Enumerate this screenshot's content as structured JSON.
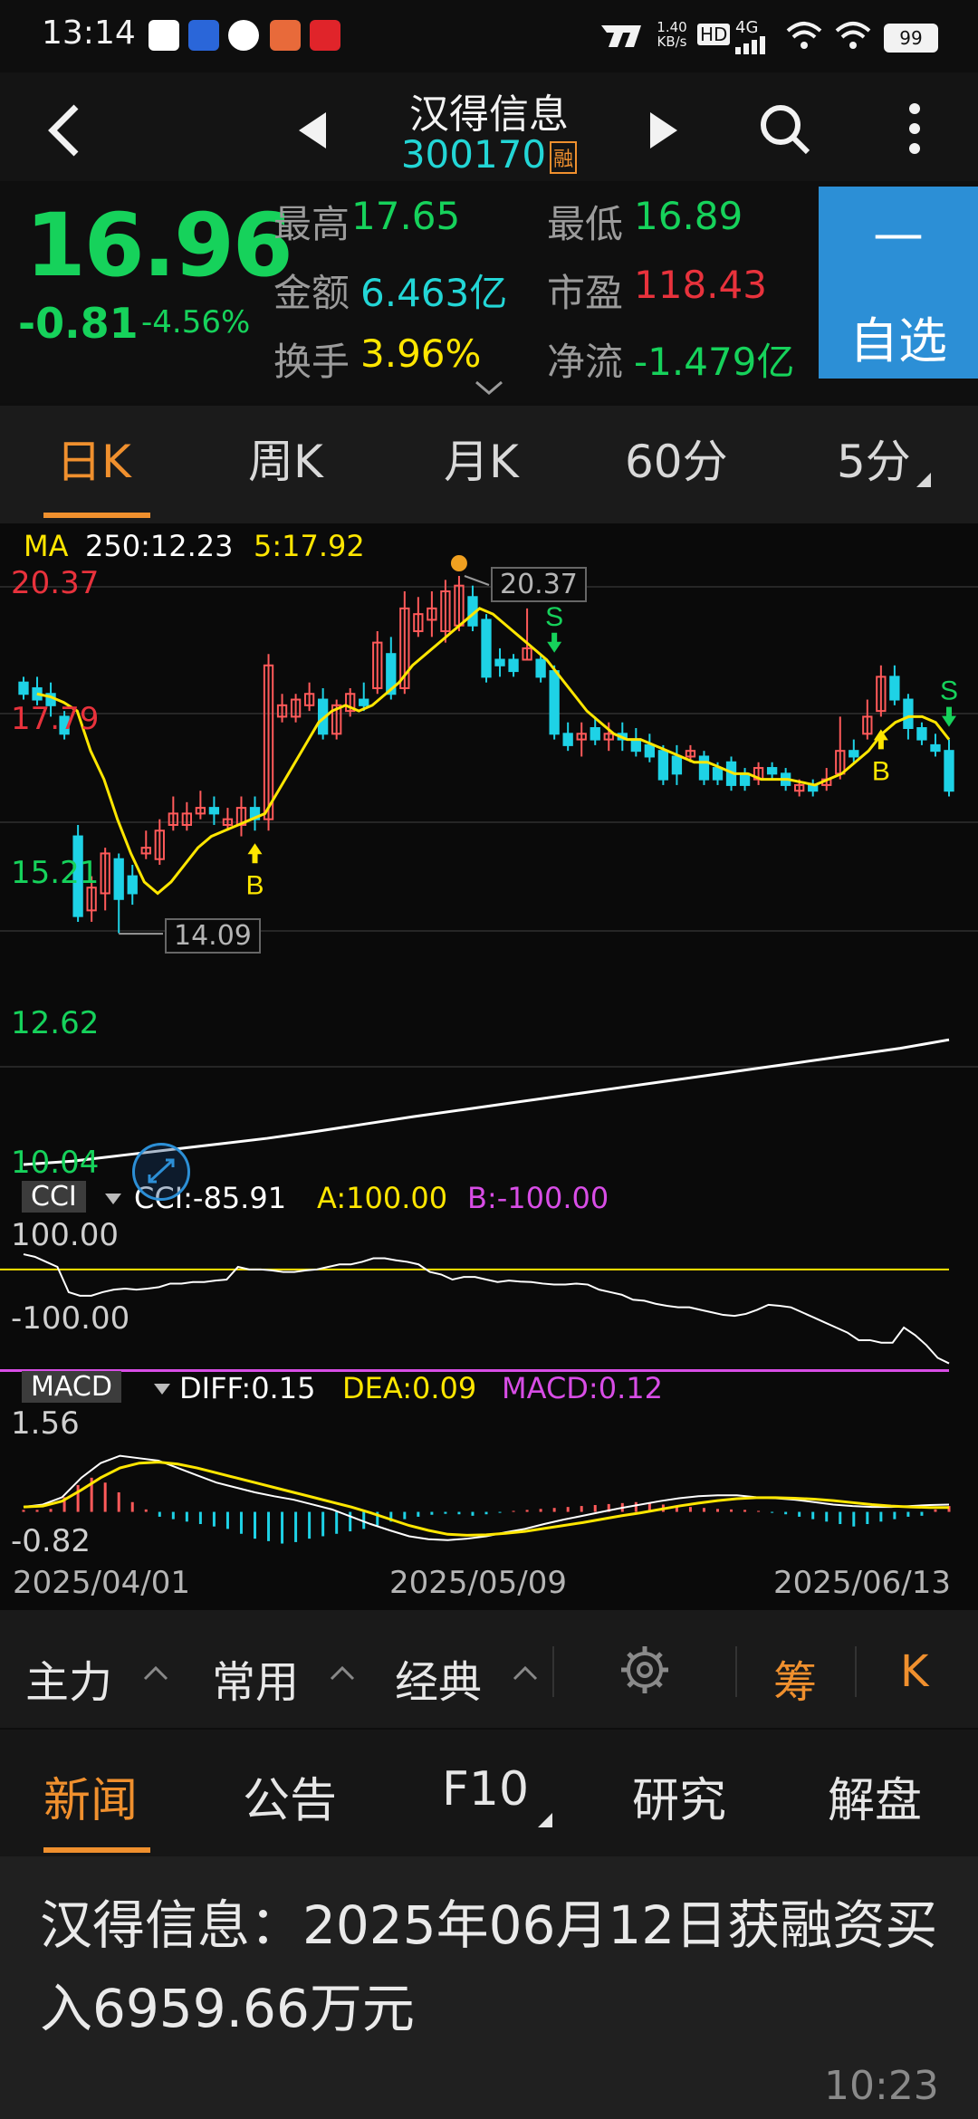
{
  "status": {
    "time": "13:14",
    "net_speed": "1.40\nKB/s",
    "hd": "HD",
    "signal": "4G",
    "battery": "99"
  },
  "header": {
    "title": "汉得信息",
    "code": "300170",
    "margin_badge": "融"
  },
  "quote": {
    "price": "16.96",
    "change": "-0.81",
    "change_pct": "-4.56%",
    "high_label": "最高",
    "high": "17.65",
    "low_label": "最低",
    "low": "16.89",
    "amount_label": "金额",
    "amount": "6.463亿",
    "pe_label": "市盈",
    "pe": "118.43",
    "turnover_label": "换手",
    "turnover": "3.96%",
    "netflow_label": "净流",
    "netflow": "-1.479亿",
    "watch_minus": "—",
    "watch_label": "自选"
  },
  "period_tabs": [
    "日K",
    "周K",
    "月K",
    "60分",
    "5分"
  ],
  "chart_data": [
    {
      "type": "candlestick",
      "title": "",
      "legend": {
        "name": "MA",
        "ma250": "250:12.23",
        "ma5": "5:17.92"
      },
      "y_labels": [
        "20.37",
        "17.79",
        "15.21",
        "12.62",
        "10.04"
      ],
      "annotations": {
        "high": "20.37",
        "low": "14.09",
        "buy": "B",
        "sell": "S"
      },
      "ylim": [
        10.04,
        20.37
      ],
      "candles": [
        {
          "o": 18.5,
          "c": 18.3,
          "h": 18.6,
          "l": 18.2
        },
        {
          "o": 18.4,
          "c": 18.2,
          "h": 18.6,
          "l": 18.1
        },
        {
          "o": 18.3,
          "c": 18.1,
          "h": 18.5,
          "l": 17.9
        },
        {
          "o": 17.9,
          "c": 17.6,
          "h": 18.0,
          "l": 17.5
        },
        {
          "o": 15.8,
          "c": 14.4,
          "h": 16.0,
          "l": 14.3
        },
        {
          "o": 14.5,
          "c": 14.9,
          "h": 15.1,
          "l": 14.3
        },
        {
          "o": 14.8,
          "c": 15.5,
          "h": 15.6,
          "l": 14.5
        },
        {
          "o": 15.4,
          "c": 14.7,
          "h": 15.5,
          "l": 14.1
        },
        {
          "o": 15.1,
          "c": 14.8,
          "h": 15.3,
          "l": 14.6
        },
        {
          "o": 15.5,
          "c": 15.6,
          "h": 15.9,
          "l": 15.4
        },
        {
          "o": 15.4,
          "c": 15.9,
          "h": 16.1,
          "l": 15.3
        },
        {
          "o": 16.0,
          "c": 16.2,
          "h": 16.5,
          "l": 15.9
        },
        {
          "o": 16.0,
          "c": 16.2,
          "h": 16.4,
          "l": 15.9
        },
        {
          "o": 16.2,
          "c": 16.3,
          "h": 16.6,
          "l": 16.1
        },
        {
          "o": 16.3,
          "c": 16.2,
          "h": 16.5,
          "l": 16.0
        },
        {
          "o": 16.0,
          "c": 16.1,
          "h": 16.3,
          "l": 15.9
        },
        {
          "o": 16.0,
          "c": 16.3,
          "h": 16.5,
          "l": 15.8
        },
        {
          "o": 16.3,
          "c": 16.1,
          "h": 16.5,
          "l": 15.9
        },
        {
          "o": 16.1,
          "c": 18.8,
          "h": 19.0,
          "l": 15.9
        },
        {
          "o": 17.9,
          "c": 18.1,
          "h": 18.3,
          "l": 17.8
        },
        {
          "o": 17.9,
          "c": 18.2,
          "h": 18.3,
          "l": 17.8
        },
        {
          "o": 18.1,
          "c": 18.3,
          "h": 18.5,
          "l": 18.0
        },
        {
          "o": 18.2,
          "c": 17.6,
          "h": 18.4,
          "l": 17.5
        },
        {
          "o": 17.6,
          "c": 18.1,
          "h": 18.2,
          "l": 17.5
        },
        {
          "o": 18.0,
          "c": 18.3,
          "h": 18.4,
          "l": 17.9
        },
        {
          "o": 18.2,
          "c": 18.1,
          "h": 18.5,
          "l": 18.0
        },
        {
          "o": 18.4,
          "c": 19.2,
          "h": 19.4,
          "l": 18.3
        },
        {
          "o": 19.0,
          "c": 18.3,
          "h": 19.3,
          "l": 18.2
        },
        {
          "o": 18.4,
          "c": 19.8,
          "h": 20.1,
          "l": 18.3
        },
        {
          "o": 19.4,
          "c": 19.7,
          "h": 20.0,
          "l": 19.3
        },
        {
          "o": 19.6,
          "c": 19.8,
          "h": 20.1,
          "l": 19.3
        },
        {
          "o": 19.4,
          "c": 20.1,
          "h": 20.3,
          "l": 19.2
        },
        {
          "o": 19.5,
          "c": 20.2,
          "h": 20.37,
          "l": 19.4
        },
        {
          "o": 20.0,
          "c": 19.5,
          "h": 20.2,
          "l": 19.4
        },
        {
          "o": 19.6,
          "c": 18.6,
          "h": 19.7,
          "l": 18.5
        },
        {
          "o": 18.9,
          "c": 18.8,
          "h": 19.1,
          "l": 18.6
        },
        {
          "o": 18.9,
          "c": 18.7,
          "h": 19.0,
          "l": 18.6
        },
        {
          "o": 18.9,
          "c": 19.1,
          "h": 19.8,
          "l": 18.9
        },
        {
          "o": 18.9,
          "c": 18.6,
          "h": 19.0,
          "l": 18.5
        },
        {
          "o": 18.7,
          "c": 17.6,
          "h": 18.8,
          "l": 17.5
        },
        {
          "o": 17.6,
          "c": 17.4,
          "h": 17.8,
          "l": 17.3
        },
        {
          "o": 17.5,
          "c": 17.6,
          "h": 17.8,
          "l": 17.2
        },
        {
          "o": 17.7,
          "c": 17.5,
          "h": 17.9,
          "l": 17.4
        },
        {
          "o": 17.5,
          "c": 17.6,
          "h": 17.8,
          "l": 17.3
        },
        {
          "o": 17.6,
          "c": 17.5,
          "h": 17.8,
          "l": 17.3
        },
        {
          "o": 17.5,
          "c": 17.3,
          "h": 17.7,
          "l": 17.2
        },
        {
          "o": 17.4,
          "c": 17.2,
          "h": 17.6,
          "l": 17.1
        },
        {
          "o": 17.3,
          "c": 16.8,
          "h": 17.4,
          "l": 16.7
        },
        {
          "o": 17.2,
          "c": 16.9,
          "h": 17.4,
          "l": 16.7
        },
        {
          "o": 17.2,
          "c": 17.3,
          "h": 17.4,
          "l": 17.1
        },
        {
          "o": 17.2,
          "c": 16.8,
          "h": 17.3,
          "l": 16.7
        },
        {
          "o": 17.0,
          "c": 16.8,
          "h": 17.1,
          "l": 16.7
        },
        {
          "o": 17.1,
          "c": 16.7,
          "h": 17.2,
          "l": 16.6
        },
        {
          "o": 16.9,
          "c": 16.7,
          "h": 17.0,
          "l": 16.6
        },
        {
          "o": 16.8,
          "c": 17.0,
          "h": 17.1,
          "l": 16.7
        },
        {
          "o": 17.0,
          "c": 16.9,
          "h": 17.1,
          "l": 16.8
        },
        {
          "o": 16.9,
          "c": 16.7,
          "h": 17.0,
          "l": 16.6
        },
        {
          "o": 16.6,
          "c": 16.7,
          "h": 16.8,
          "l": 16.5
        },
        {
          "o": 16.7,
          "c": 16.6,
          "h": 16.8,
          "l": 16.5
        },
        {
          "o": 16.7,
          "c": 16.8,
          "h": 17.0,
          "l": 16.6
        },
        {
          "o": 16.9,
          "c": 17.3,
          "h": 17.9,
          "l": 16.8
        },
        {
          "o": 17.3,
          "c": 17.2,
          "h": 17.5,
          "l": 17.1
        },
        {
          "o": 17.6,
          "c": 17.9,
          "h": 18.2,
          "l": 17.5
        },
        {
          "o": 18.0,
          "c": 18.6,
          "h": 18.8,
          "l": 17.9
        },
        {
          "o": 18.6,
          "c": 18.2,
          "h": 18.8,
          "l": 18.1
        },
        {
          "o": 18.2,
          "c": 17.7,
          "h": 18.3,
          "l": 17.5
        },
        {
          "o": 17.7,
          "c": 17.5,
          "h": 17.8,
          "l": 17.4
        },
        {
          "o": 17.4,
          "c": 17.3,
          "h": 17.6,
          "l": 17.2
        },
        {
          "o": 17.3,
          "c": 16.6,
          "h": 17.5,
          "l": 16.5
        }
      ],
      "ma5": [
        18.3,
        18.25,
        18.15,
        18.0,
        17.3,
        16.8,
        16.1,
        15.5,
        15.0,
        14.8,
        15.0,
        15.3,
        15.6,
        15.8,
        15.9,
        16.0,
        16.1,
        16.2,
        16.6,
        17.0,
        17.4,
        17.8,
        18.0,
        18.1,
        18.0,
        18.1,
        18.3,
        18.5,
        18.8,
        19.0,
        19.2,
        19.4,
        19.6,
        19.8,
        19.7,
        19.5,
        19.3,
        19.1,
        18.9,
        18.6,
        18.3,
        18.0,
        17.8,
        17.6,
        17.5,
        17.5,
        17.4,
        17.3,
        17.2,
        17.1,
        17.1,
        17.0,
        16.9,
        16.9,
        16.8,
        16.8,
        16.8,
        16.75,
        16.7,
        16.8,
        16.9,
        17.1,
        17.3,
        17.6,
        17.8,
        17.9,
        17.9,
        17.8,
        17.5
      ],
      "ma250": [
        10.04,
        10.1,
        10.2,
        10.3,
        10.4,
        10.5,
        10.62,
        10.75,
        10.88,
        11.0,
        11.12,
        11.24,
        11.36,
        11.48,
        11.6,
        11.72,
        11.84,
        11.96,
        12.08,
        12.23
      ]
    },
    {
      "type": "line",
      "title": "",
      "legend": {
        "name": "CCI",
        "cci": "CCI:-85.91",
        "a": "A:100.00",
        "b": "B:-100.00"
      },
      "y_labels": [
        "100.00",
        "-100.00"
      ],
      "ylim": [
        -100,
        100
      ],
      "values": [
        130,
        125,
        115,
        105,
        55,
        48,
        48,
        55,
        60,
        62,
        60,
        62,
        65,
        72,
        72,
        75,
        75,
        78,
        80,
        105,
        100,
        100,
        98,
        95,
        95,
        98,
        100,
        105,
        110,
        110,
        115,
        122,
        122,
        118,
        115,
        110,
        95,
        90,
        80,
        85,
        85,
        80,
        75,
        78,
        76,
        75,
        72,
        70,
        70,
        72,
        70,
        60,
        55,
        50,
        40,
        38,
        32,
        28,
        25,
        25,
        20,
        15,
        10,
        8,
        12,
        20,
        30,
        28,
        25,
        15,
        5,
        -5,
        -15,
        -25,
        -40,
        -40,
        -45,
        -45,
        -15,
        -30,
        -50,
        -75,
        -85.91
      ]
    },
    {
      "type": "bar",
      "title": "",
      "legend": {
        "name": "MACD",
        "diff": "DIFF:0.15",
        "dea": "DEA:0.09",
        "macd": "MACD:0.12"
      },
      "y_labels": [
        "1.56",
        "-0.82"
      ],
      "ylim": [
        -0.82,
        1.56
      ],
      "macd": [
        0.04,
        0.04,
        0.06,
        0.3,
        0.55,
        0.7,
        0.6,
        0.4,
        0.2,
        0.05,
        -0.1,
        -0.15,
        -0.2,
        -0.25,
        -0.3,
        -0.35,
        -0.45,
        -0.55,
        -0.6,
        -0.65,
        -0.62,
        -0.55,
        -0.5,
        -0.45,
        -0.4,
        -0.35,
        -0.28,
        -0.2,
        -0.15,
        -0.1,
        -0.06,
        -0.04,
        -0.05,
        -0.08,
        -0.05,
        -0.02,
        0.02,
        0.04,
        0.06,
        0.08,
        0.1,
        0.12,
        0.14,
        0.16,
        0.18,
        0.2,
        0.17,
        0.15,
        0.12,
        0.1,
        0.08,
        0.06,
        0.05,
        0.04,
        0.02,
        -0.02,
        -0.05,
        -0.1,
        -0.15,
        -0.2,
        -0.25,
        -0.3,
        -0.25,
        -0.2,
        -0.15,
        -0.1,
        -0.08,
        0.05,
        0.12
      ],
      "diff": [
        0.1,
        0.15,
        0.3,
        0.7,
        1.0,
        1.15,
        1.1,
        1.05,
        0.9,
        0.75,
        0.6,
        0.5,
        0.4,
        0.32,
        0.25,
        0.15,
        0.05,
        -0.1,
        -0.25,
        -0.38,
        -0.5,
        -0.56,
        -0.58,
        -0.55,
        -0.5,
        -0.42,
        -0.35,
        -0.25,
        -0.16,
        -0.08,
        0.0,
        0.08,
        0.15,
        0.22,
        0.28,
        0.32,
        0.34,
        0.34,
        0.3,
        0.28,
        0.25,
        0.2,
        0.15,
        0.12,
        0.1,
        0.1,
        0.12,
        0.14,
        0.15
      ],
      "dea": [
        0.1,
        0.12,
        0.22,
        0.45,
        0.7,
        0.9,
        1.0,
        1.02,
        0.98,
        0.9,
        0.8,
        0.7,
        0.6,
        0.5,
        0.4,
        0.3,
        0.2,
        0.1,
        -0.02,
        -0.15,
        -0.28,
        -0.38,
        -0.46,
        -0.48,
        -0.47,
        -0.44,
        -0.4,
        -0.34,
        -0.28,
        -0.22,
        -0.15,
        -0.08,
        -0.02,
        0.05,
        0.12,
        0.18,
        0.23,
        0.27,
        0.29,
        0.29,
        0.28,
        0.26,
        0.23,
        0.19,
        0.15,
        0.12,
        0.1,
        0.09,
        0.09
      ]
    }
  ],
  "x_labels": [
    "2025/04/01",
    "2025/05/09",
    "2025/06/13"
  ],
  "colors": {
    "up": "#ff5a5a",
    "down": "#1ed2e6",
    "ma5": "#ffe600",
    "ma250": "#ffffff",
    "cci_line": "#ffffff",
    "cci_a": "#ffe600",
    "cci_b": "#d84de6",
    "macd_diff": "#ffffff",
    "macd_dea": "#ffe600"
  },
  "toolbar": {
    "main": "主力",
    "common": "常用",
    "classic": "经典",
    "chip": "筹",
    "k": "K",
    "settings_icon": "gear-icon"
  },
  "news_tabs": [
    "新闻",
    "公告",
    "F10",
    "研究",
    "解盘"
  ],
  "news": {
    "headline": "汉得信息：2025年06月12日获融资买入6959.66万元",
    "time": "10:23"
  }
}
